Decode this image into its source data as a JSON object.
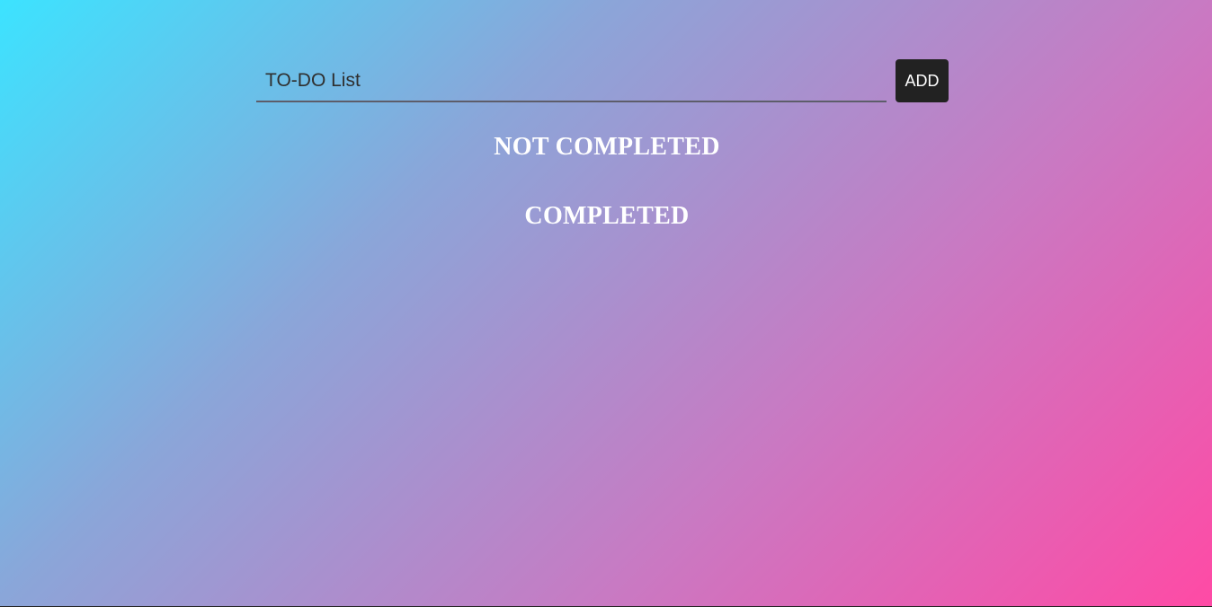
{
  "todo": {
    "input_value": "TO-DO List",
    "add_button_label": "ADD",
    "not_completed_heading": "NOT COMPLETED",
    "completed_heading": "COMPLETED",
    "not_completed_items": [],
    "completed_items": []
  },
  "colors": {
    "gradient_start": "#3ce3ff",
    "gradient_end": "#ff4aa5",
    "button_bg": "#222222",
    "heading_text": "#ffffff"
  }
}
